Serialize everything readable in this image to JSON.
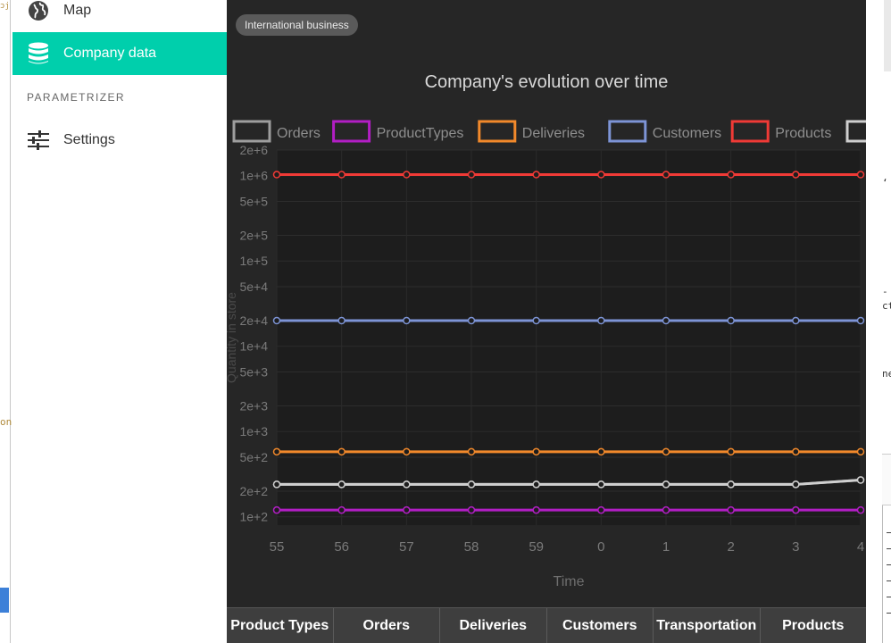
{
  "sidebar": {
    "items": [
      {
        "label": "Map",
        "icon": "globe-icon"
      },
      {
        "label": "Company data",
        "icon": "database-icon",
        "active": true
      }
    ],
    "section_title": "PARAMETRIZER",
    "settings": {
      "label": "Settings",
      "icon": "sliders-icon"
    }
  },
  "main": {
    "badge": "International business",
    "table_headers": [
      "Product Types",
      "Orders",
      "Deliveries",
      "Customers",
      "Transportation",
      "Products"
    ]
  },
  "colors": {
    "accent": "#00cfac",
    "panel_bg": "#262626"
  },
  "chart_data": {
    "type": "line",
    "title": "Company's evolution over time",
    "xlabel": "Time",
    "ylabel": "Quantity in store",
    "y_scale": "log",
    "y_ticks": [
      "2e+6",
      "1e+6",
      "5e+5",
      "2e+5",
      "1e+5",
      "5e+4",
      "2e+4",
      "1e+4",
      "5e+3",
      "2e+3",
      "1e+3",
      "5e+2",
      "2e+2",
      "1e+2"
    ],
    "y_tick_values": [
      2000000,
      1000000,
      500000,
      200000,
      100000,
      50000,
      20000,
      10000,
      5000,
      2000,
      1000,
      500,
      200,
      100
    ],
    "ylim": [
      80,
      2000000
    ],
    "categories": [
      "55",
      "56",
      "57",
      "58",
      "59",
      "0",
      "1",
      "2",
      "3",
      "4"
    ],
    "legend_position": "top",
    "grid": true,
    "series": [
      {
        "name": "Orders",
        "color": "#9e9e9e",
        "values": [
          240,
          240,
          240,
          240,
          240,
          240,
          240,
          240,
          240,
          270
        ]
      },
      {
        "name": "ProductTypes",
        "color": "#b21ec4",
        "values": [
          120,
          120,
          120,
          120,
          120,
          120,
          120,
          120,
          120,
          120
        ]
      },
      {
        "name": "Deliveries",
        "color": "#f2892b",
        "values": [
          580,
          580,
          580,
          580,
          580,
          580,
          580,
          580,
          580,
          580
        ]
      },
      {
        "name": "Customers",
        "color": "#7d94d6",
        "values": [
          20000,
          20000,
          20000,
          20000,
          20000,
          20000,
          20000,
          20000,
          20000,
          20000
        ]
      },
      {
        "name": "Products",
        "color": "#f03a36",
        "values": [
          1030000,
          1030000,
          1030000,
          1030000,
          1030000,
          1030000,
          1030000,
          1030000,
          1030000,
          1030000
        ]
      },
      {
        "name": "Transportation",
        "color": "#cfcfcf",
        "values": [
          240,
          240,
          240,
          240,
          240,
          240,
          240,
          240,
          240,
          270
        ]
      }
    ]
  }
}
